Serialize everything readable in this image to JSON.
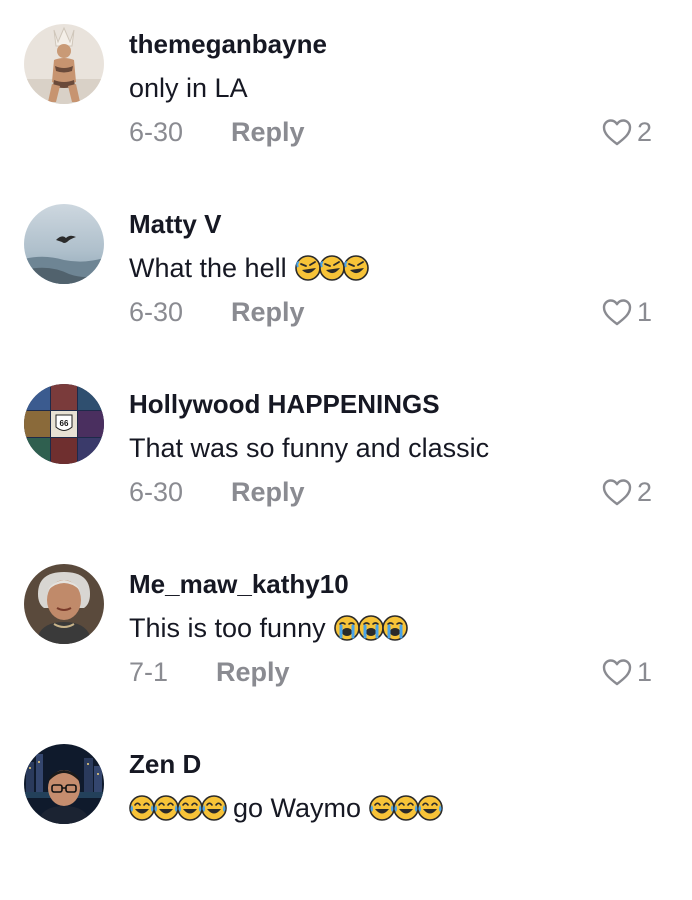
{
  "comments": [
    {
      "username": "themeganbayne",
      "text": "only in LA",
      "trailing_emoji": [],
      "leading_emoji": [],
      "after_text": "",
      "date": "6-30",
      "reply_label": "Reply",
      "likes": "2",
      "avatar": "person-with-headdress-avatar"
    },
    {
      "username": "Matty V",
      "text": "What the hell",
      "trailing_emoji": [
        "rolling-on-floor-laughing",
        "rolling-on-floor-laughing",
        "rolling-on-floor-laughing"
      ],
      "leading_emoji": [],
      "after_text": "",
      "date": "6-30",
      "reply_label": "Reply",
      "likes": "1",
      "avatar": "bird-over-sea-avatar"
    },
    {
      "username": "Hollywood HAPPENINGS",
      "text": "That was so funny and classic",
      "trailing_emoji": [],
      "leading_emoji": [],
      "after_text": "",
      "date": "6-30",
      "reply_label": "Reply",
      "likes": "2",
      "avatar": "route-66-collage-avatar"
    },
    {
      "username": "Me_maw_kathy10",
      "text": "This is too funny",
      "trailing_emoji": [
        "loudly-crying-face",
        "loudly-crying-face",
        "loudly-crying-face"
      ],
      "leading_emoji": [],
      "after_text": "",
      "date": "7-1",
      "reply_label": "Reply",
      "likes": "1",
      "avatar": "gray-haired-woman-avatar"
    },
    {
      "username": "Zen D",
      "text": "go Waymo",
      "leading_emoji": [
        "face-with-tears-of-joy",
        "face-with-tears-of-joy",
        "face-with-tears-of-joy",
        "face-with-tears-of-joy"
      ],
      "trailing_emoji": [
        "face-with-tears-of-joy",
        "face-with-tears-of-joy",
        "face-with-tears-of-joy"
      ],
      "after_text": "",
      "date": "",
      "reply_label": "",
      "likes": "",
      "avatar": "man-with-glasses-night-city-avatar"
    }
  ],
  "colors": {
    "text": "#161823",
    "muted": "#8a8b91",
    "emoji_yellow": "#f7c338",
    "emoji_tear": "#4aa3e8"
  }
}
